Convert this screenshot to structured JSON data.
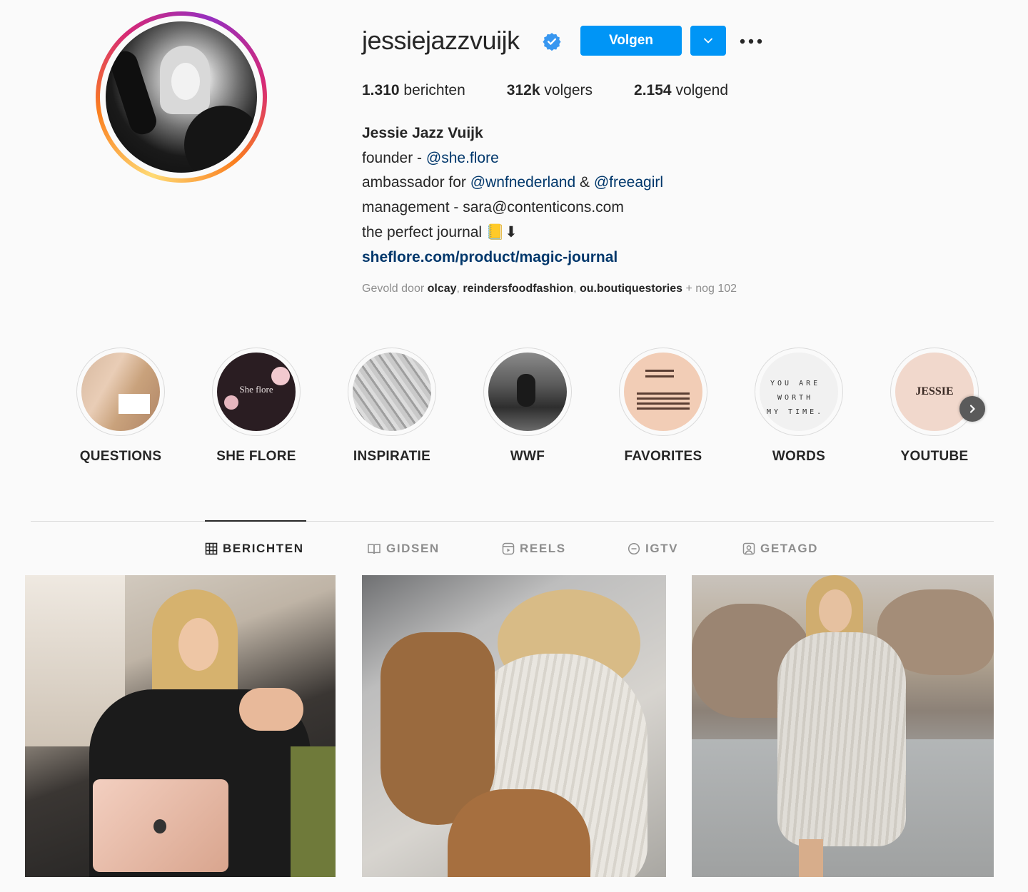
{
  "profile": {
    "username": "jessiejazzvuijk",
    "verified": true,
    "follow_label": "Volgen",
    "stats": {
      "posts_count": "1.310",
      "posts_label": " berichten",
      "followers_count": "312k",
      "followers_label": " volgers",
      "following_count": "2.154",
      "following_label": " volgend"
    },
    "bio": {
      "full_name": "Jessie Jazz Vuijk",
      "line1_prefix": "founder - ",
      "line1_mention": "@she.flore",
      "line2_prefix": "ambassador for ",
      "line2_mention1": "@wnfnederland",
      "line2_between": " & ",
      "line2_mention2": "@freeagirl",
      "line3": "management - sara@contenticons.com",
      "line4": "the perfect journal 📒⬇",
      "link": "sheflore.com/product/magic-journal"
    },
    "followed_by": {
      "prefix": "Gevold door ",
      "user1": "olcay",
      "sep1": ", ",
      "user2": "reindersfoodfashion",
      "sep2": ", ",
      "user3": "ou.boutiquestories",
      "suffix": " + nog 102"
    }
  },
  "highlights": [
    {
      "label": "QUESTIONS"
    },
    {
      "label": "SHE FLORE",
      "cover_text": "She flore"
    },
    {
      "label": "INSPIRATIE"
    },
    {
      "label": "WWF"
    },
    {
      "label": "FAVORITES"
    },
    {
      "label": "WORDS",
      "cover_text_1": "YOU ARE",
      "cover_text_2": "WORTH",
      "cover_text_3": "MY TIME."
    },
    {
      "label": "YOUTUBE",
      "cover_text": "JESSIE"
    }
  ],
  "tabs": [
    {
      "label": "BERICHTEN",
      "icon": "grid-icon",
      "active": true
    },
    {
      "label": "GIDSEN",
      "icon": "guide-icon",
      "active": false
    },
    {
      "label": "REELS",
      "icon": "reels-icon",
      "active": false
    },
    {
      "label": "IGTV",
      "icon": "igtv-icon",
      "active": false
    },
    {
      "label": "GETAGD",
      "icon": "tagged-icon",
      "active": false
    }
  ],
  "colors": {
    "accent": "#0095f6",
    "link": "#00376b",
    "text": "#262626",
    "muted": "#8e8e8e",
    "background": "#fafafa"
  }
}
